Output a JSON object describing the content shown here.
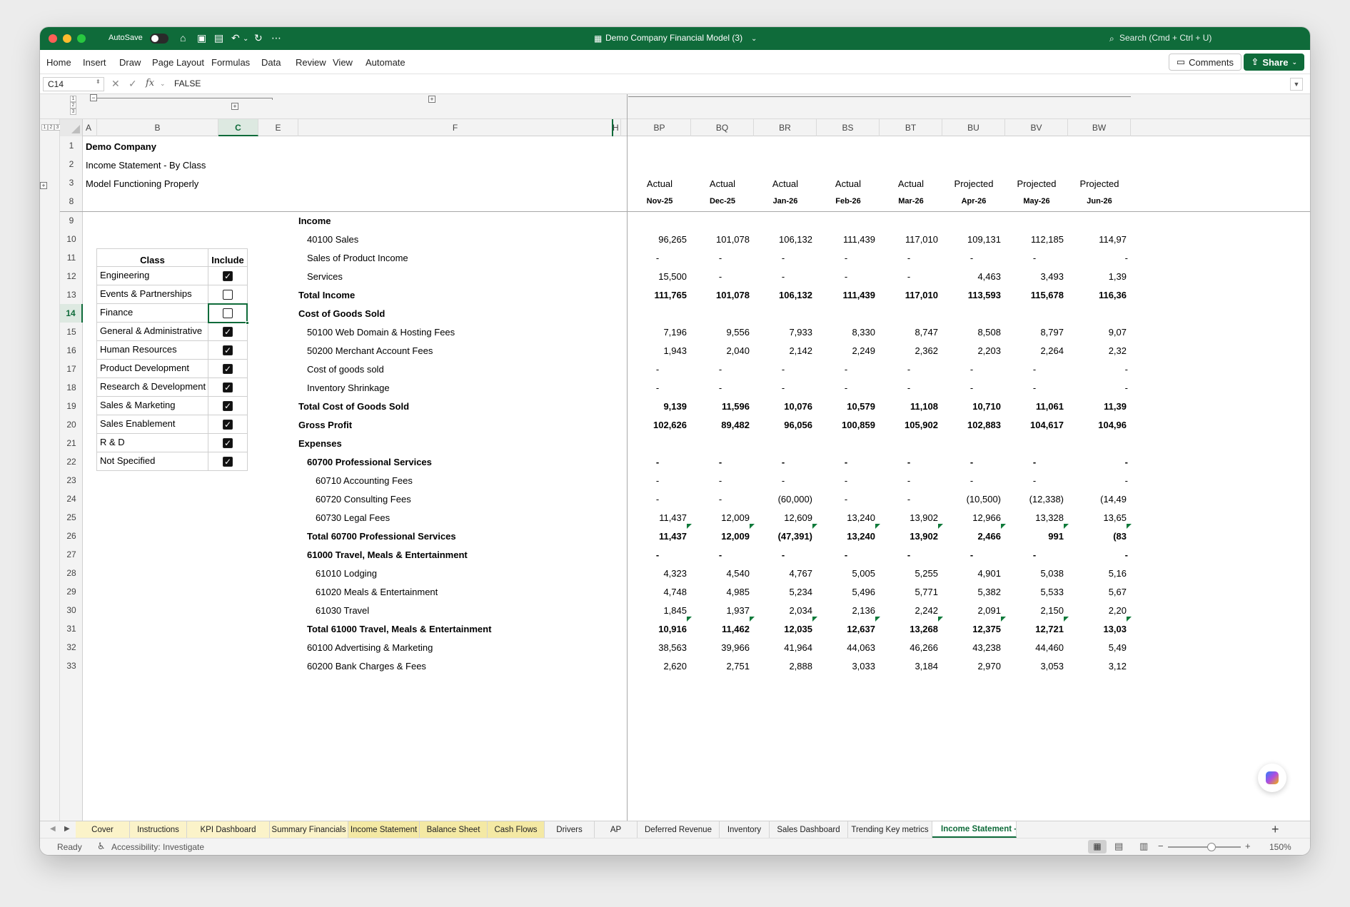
{
  "window": {
    "title": "Demo Company Financial Model (3)",
    "autosave_label": "AutoSave",
    "search_placeholder": "Search (Cmd + Ctrl + U)"
  },
  "ribbon": {
    "tabs": [
      "Home",
      "Insert",
      "Draw",
      "Page Layout",
      "Formulas",
      "Data",
      "Review",
      "View",
      "Automate"
    ],
    "comments_label": "Comments",
    "share_label": "Share"
  },
  "formula_bar": {
    "cell_ref": "C14",
    "formula": "FALSE",
    "fx_label": "fx"
  },
  "outline": {
    "row_levels": [
      "1",
      "2",
      "3"
    ],
    "col_levels": [
      "1",
      "2",
      "3"
    ]
  },
  "columns": [
    "A",
    "B",
    "C",
    "E",
    "F",
    "H",
    "BP",
    "BQ",
    "BR",
    "BS",
    "BT",
    "BU",
    "BV",
    "BW"
  ],
  "header_rows": [
    {
      "num": "1",
      "a": "Demo Company",
      "bold": true
    },
    {
      "num": "2",
      "a": "Income Statement - By Class",
      "bold": false
    },
    {
      "num": "3",
      "a": "Model Functioning Properly",
      "bold": false
    }
  ],
  "row8_num": "8",
  "col_status": [
    "Actual",
    "Actual",
    "Actual",
    "Actual",
    "Actual",
    "Projected",
    "Projected",
    "Projected"
  ],
  "col_periods": [
    "Nov-25",
    "Dec-25",
    "Jan-26",
    "Feb-26",
    "Mar-26",
    "Apr-26",
    "May-26",
    "Jun-26"
  ],
  "class_table": {
    "header_class": "Class",
    "header_include": "Include",
    "items": [
      {
        "name": "Engineering",
        "include": true
      },
      {
        "name": "Events & Partnerships",
        "include": false
      },
      {
        "name": "Finance",
        "include": false
      },
      {
        "name": "General & Administrative",
        "include": true
      },
      {
        "name": "Human Resources",
        "include": true
      },
      {
        "name": "Product Development",
        "include": true
      },
      {
        "name": "Research & Development",
        "include": true
      },
      {
        "name": "Sales & Marketing",
        "include": true
      },
      {
        "name": "Sales Enablement",
        "include": true
      },
      {
        "name": "R & D",
        "include": true
      },
      {
        "name": "Not Specified",
        "include": true
      }
    ]
  },
  "rows": [
    {
      "num": "9",
      "label": "Income",
      "indent": 0,
      "bold": true,
      "values": [
        "",
        "",
        "",
        "",
        "",
        "",
        "",
        ""
      ]
    },
    {
      "num": "10",
      "label": "40100 Sales",
      "indent": 1,
      "bold": false,
      "values": [
        "96,265",
        "101,078",
        "106,132",
        "111,439",
        "117,010",
        "109,131",
        "112,185",
        "114,97"
      ]
    },
    {
      "num": "11",
      "label": "Sales of Product Income",
      "indent": 1,
      "bold": false,
      "values": [
        "-",
        "-",
        "-",
        "-",
        "-",
        "-",
        "-",
        "-"
      ]
    },
    {
      "num": "12",
      "label": "Services",
      "indent": 1,
      "bold": false,
      "values": [
        "15,500",
        "-",
        "-",
        "-",
        "-",
        "4,463",
        "3,493",
        "1,39"
      ]
    },
    {
      "num": "13",
      "label": "Total Income",
      "indent": 0,
      "bold": true,
      "values": [
        "111,765",
        "101,078",
        "106,132",
        "111,439",
        "117,010",
        "113,593",
        "115,678",
        "116,36"
      ]
    },
    {
      "num": "14",
      "label": "Cost of Goods Sold",
      "indent": 0,
      "bold": true,
      "values": [
        "",
        "",
        "",
        "",
        "",
        "",
        "",
        ""
      ]
    },
    {
      "num": "15",
      "label": "50100 Web Domain & Hosting Fees",
      "indent": 1,
      "bold": false,
      "values": [
        "7,196",
        "9,556",
        "7,933",
        "8,330",
        "8,747",
        "8,508",
        "8,797",
        "9,07"
      ]
    },
    {
      "num": "16",
      "label": "50200 Merchant Account Fees",
      "indent": 1,
      "bold": false,
      "values": [
        "1,943",
        "2,040",
        "2,142",
        "2,249",
        "2,362",
        "2,203",
        "2,264",
        "2,32"
      ]
    },
    {
      "num": "17",
      "label": "Cost of goods sold",
      "indent": 1,
      "bold": false,
      "values": [
        "-",
        "-",
        "-",
        "-",
        "-",
        "-",
        "-",
        "-"
      ]
    },
    {
      "num": "18",
      "label": "Inventory Shrinkage",
      "indent": 1,
      "bold": false,
      "values": [
        "-",
        "-",
        "-",
        "-",
        "-",
        "-",
        "-",
        "-"
      ]
    },
    {
      "num": "19",
      "label": "Total Cost of Goods Sold",
      "indent": 0,
      "bold": true,
      "values": [
        "9,139",
        "11,596",
        "10,076",
        "10,579",
        "11,108",
        "10,710",
        "11,061",
        "11,39"
      ]
    },
    {
      "num": "20",
      "label": "Gross Profit",
      "indent": 0,
      "bold": true,
      "values": [
        "102,626",
        "89,482",
        "96,056",
        "100,859",
        "105,902",
        "102,883",
        "104,617",
        "104,96"
      ]
    },
    {
      "num": "21",
      "label": "Expenses",
      "indent": 0,
      "bold": true,
      "values": [
        "",
        "",
        "",
        "",
        "",
        "",
        "",
        ""
      ]
    },
    {
      "num": "22",
      "label": "60700 Professional Services",
      "indent": 1,
      "bold": true,
      "values": [
        "-",
        "-",
        "-",
        "-",
        "-",
        "-",
        "-",
        "-"
      ]
    },
    {
      "num": "23",
      "label": "60710 Accounting Fees",
      "indent": 2,
      "bold": false,
      "values": [
        "-",
        "-",
        "-",
        "-",
        "-",
        "-",
        "-",
        "-"
      ]
    },
    {
      "num": "24",
      "label": "60720 Consulting Fees",
      "indent": 2,
      "bold": false,
      "values": [
        "-",
        "-",
        "(60,000)",
        "-",
        "-",
        "(10,500)",
        "(12,338)",
        "(14,49"
      ]
    },
    {
      "num": "25",
      "label": "60730 Legal Fees",
      "indent": 2,
      "bold": false,
      "flag": true,
      "values": [
        "11,437",
        "12,009",
        "12,609",
        "13,240",
        "13,902",
        "12,966",
        "13,328",
        "13,65"
      ]
    },
    {
      "num": "26",
      "label": "Total 60700 Professional Services",
      "indent": 1,
      "bold": true,
      "values": [
        "11,437",
        "12,009",
        "(47,391)",
        "13,240",
        "13,902",
        "2,466",
        "991",
        "(83"
      ]
    },
    {
      "num": "27",
      "label": "61000 Travel, Meals & Entertainment",
      "indent": 1,
      "bold": true,
      "values": [
        "-",
        "-",
        "-",
        "-",
        "-",
        "-",
        "-",
        "-"
      ]
    },
    {
      "num": "28",
      "label": "61010 Lodging",
      "indent": 2,
      "bold": false,
      "values": [
        "4,323",
        "4,540",
        "4,767",
        "5,005",
        "5,255",
        "4,901",
        "5,038",
        "5,16"
      ]
    },
    {
      "num": "29",
      "label": "61020 Meals & Entertainment",
      "indent": 2,
      "bold": false,
      "values": [
        "4,748",
        "4,985",
        "5,234",
        "5,496",
        "5,771",
        "5,382",
        "5,533",
        "5,67"
      ]
    },
    {
      "num": "30",
      "label": "61030 Travel",
      "indent": 2,
      "bold": false,
      "flag": true,
      "values": [
        "1,845",
        "1,937",
        "2,034",
        "2,136",
        "2,242",
        "2,091",
        "2,150",
        "2,20"
      ]
    },
    {
      "num": "31",
      "label": "Total 61000 Travel, Meals & Entertainment",
      "indent": 1,
      "bold": true,
      "values": [
        "10,916",
        "11,462",
        "12,035",
        "12,637",
        "13,268",
        "12,375",
        "12,721",
        "13,03"
      ]
    },
    {
      "num": "32",
      "label": "60100 Advertising & Marketing",
      "indent": 1,
      "bold": false,
      "values": [
        "38,563",
        "39,966",
        "41,964",
        "44,063",
        "46,266",
        "43,238",
        "44,460",
        "5,49"
      ]
    },
    {
      "num": "33",
      "label": "60200 Bank Charges & Fees",
      "indent": 1,
      "bold": false,
      "values": [
        "2,620",
        "2,751",
        "2,888",
        "3,033",
        "3,184",
        "2,970",
        "3,053",
        "3,12"
      ]
    }
  ],
  "sheet_tabs": [
    {
      "label": "Cover",
      "color": "#fbf3c9"
    },
    {
      "label": "Instructions",
      "color": "#fbf3c9"
    },
    {
      "label": "KPI Dashboard",
      "color": "#fbf3c9"
    },
    {
      "label": "Summary Financials",
      "color": "#fbf3c9"
    },
    {
      "label": "Income Statement",
      "color": "#f4e9a4"
    },
    {
      "label": "Balance Sheet",
      "color": "#f4e9a4"
    },
    {
      "label": "Cash Flows",
      "color": "#f4e9a4"
    },
    {
      "label": "Drivers",
      "color": "#f3f3f3"
    },
    {
      "label": "AP",
      "color": "#f3f3f3"
    },
    {
      "label": "Deferred Revenue",
      "color": "#f3f3f3"
    },
    {
      "label": "Inventory",
      "color": "#f3f3f3"
    },
    {
      "label": "Sales Dashboard",
      "color": "#f3f3f3"
    },
    {
      "label": "Trending Key metrics",
      "color": "#f3f3f3"
    },
    {
      "label": "Income Statement - By Cl",
      "color": "#ffffff",
      "active": true
    }
  ],
  "status": {
    "ready": "Ready",
    "accessibility": "Accessibility: Investigate",
    "zoom": "150%"
  },
  "colors": {
    "brand": "#0f6b3a",
    "grid_line": "#e3e3e3",
    "header_bg": "#f3f3f3"
  }
}
